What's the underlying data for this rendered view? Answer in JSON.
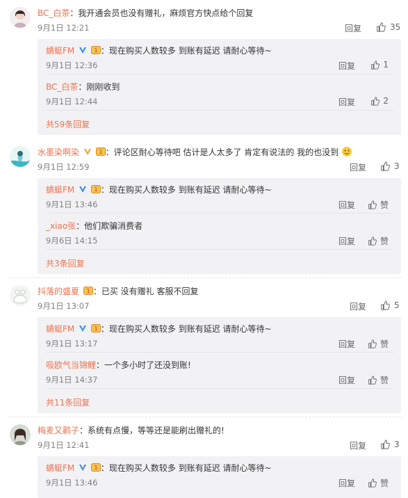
{
  "threads": [
    {
      "user": "BC_白茶",
      "text": "：我开通会员也没有赠礼，麻烦官方快点给个回复",
      "time": "9月1日 12:21",
      "reply_label": "回复",
      "likes": "35",
      "replies": [
        {
          "user": "蜻蜓FM",
          "text": "：现在购买人数较多 到账有延迟 请耐心等待~",
          "time": "9月1日 12:36",
          "reply_label": "回复",
          "likes": "1"
        },
        {
          "user": "BC_白茶",
          "text": "：刚刚收到",
          "time": "9月1日 12:44",
          "reply_label": "回复",
          "likes": "2"
        }
      ],
      "more": "共59条回复"
    },
    {
      "user": "水墨染啊染",
      "text": "：评论区耐心等待吧 估计是人太多了 肯定有说法的 我的也没到",
      "time": "9月1日 12:59",
      "reply_label": "回复",
      "likes": "3",
      "replies": [
        {
          "user": "蜻蜓FM",
          "text": "：现在购买人数较多 到账有延迟 请耐心等待~",
          "time": "9月1日 13:46",
          "reply_label": "回复",
          "likes": "赞"
        },
        {
          "user": "_xiao张",
          "text": "：他们欺骗消费者",
          "time": "9月6日 14:15",
          "reply_label": "回复",
          "likes": "赞"
        }
      ],
      "more": "共3条回复"
    },
    {
      "user": "抖落的盛夏",
      "text": "：已买 没有赠礼 客服不回复",
      "time": "9月1日 13:07",
      "reply_label": "回复",
      "likes": "5",
      "replies": [
        {
          "user": "蜻蜓FM",
          "text": "：现在购买人数较多 到账有延迟 请耐心等待~",
          "time": "9月1日 13:17",
          "reply_label": "回复",
          "likes": "赞"
        },
        {
          "user": "吸欧气当锦鲤",
          "text": "：一个多小时了还没到账!",
          "time": "9月1日 14:37",
          "reply_label": "回复",
          "likes": "赞"
        }
      ],
      "more": "共11条回复"
    },
    {
      "user": "梅麦又鹳子",
      "text": "：系统有点慢，等等还是能刷出赠礼的!",
      "time": "9月1日 12:41",
      "reply_label": "回复",
      "likes": "3",
      "replies": [
        {
          "user": "蜻蜓FM",
          "text": "：现在购买人数较多 到账有延迟 请耐心等待~",
          "time": "9月1日 13:46",
          "reply_label": "回复",
          "likes": "赞"
        }
      ],
      "more": ""
    }
  ],
  "colors": {
    "username": "#eb7350",
    "reply_box_bg": "#f2f2f5",
    "meta": "#808080"
  }
}
